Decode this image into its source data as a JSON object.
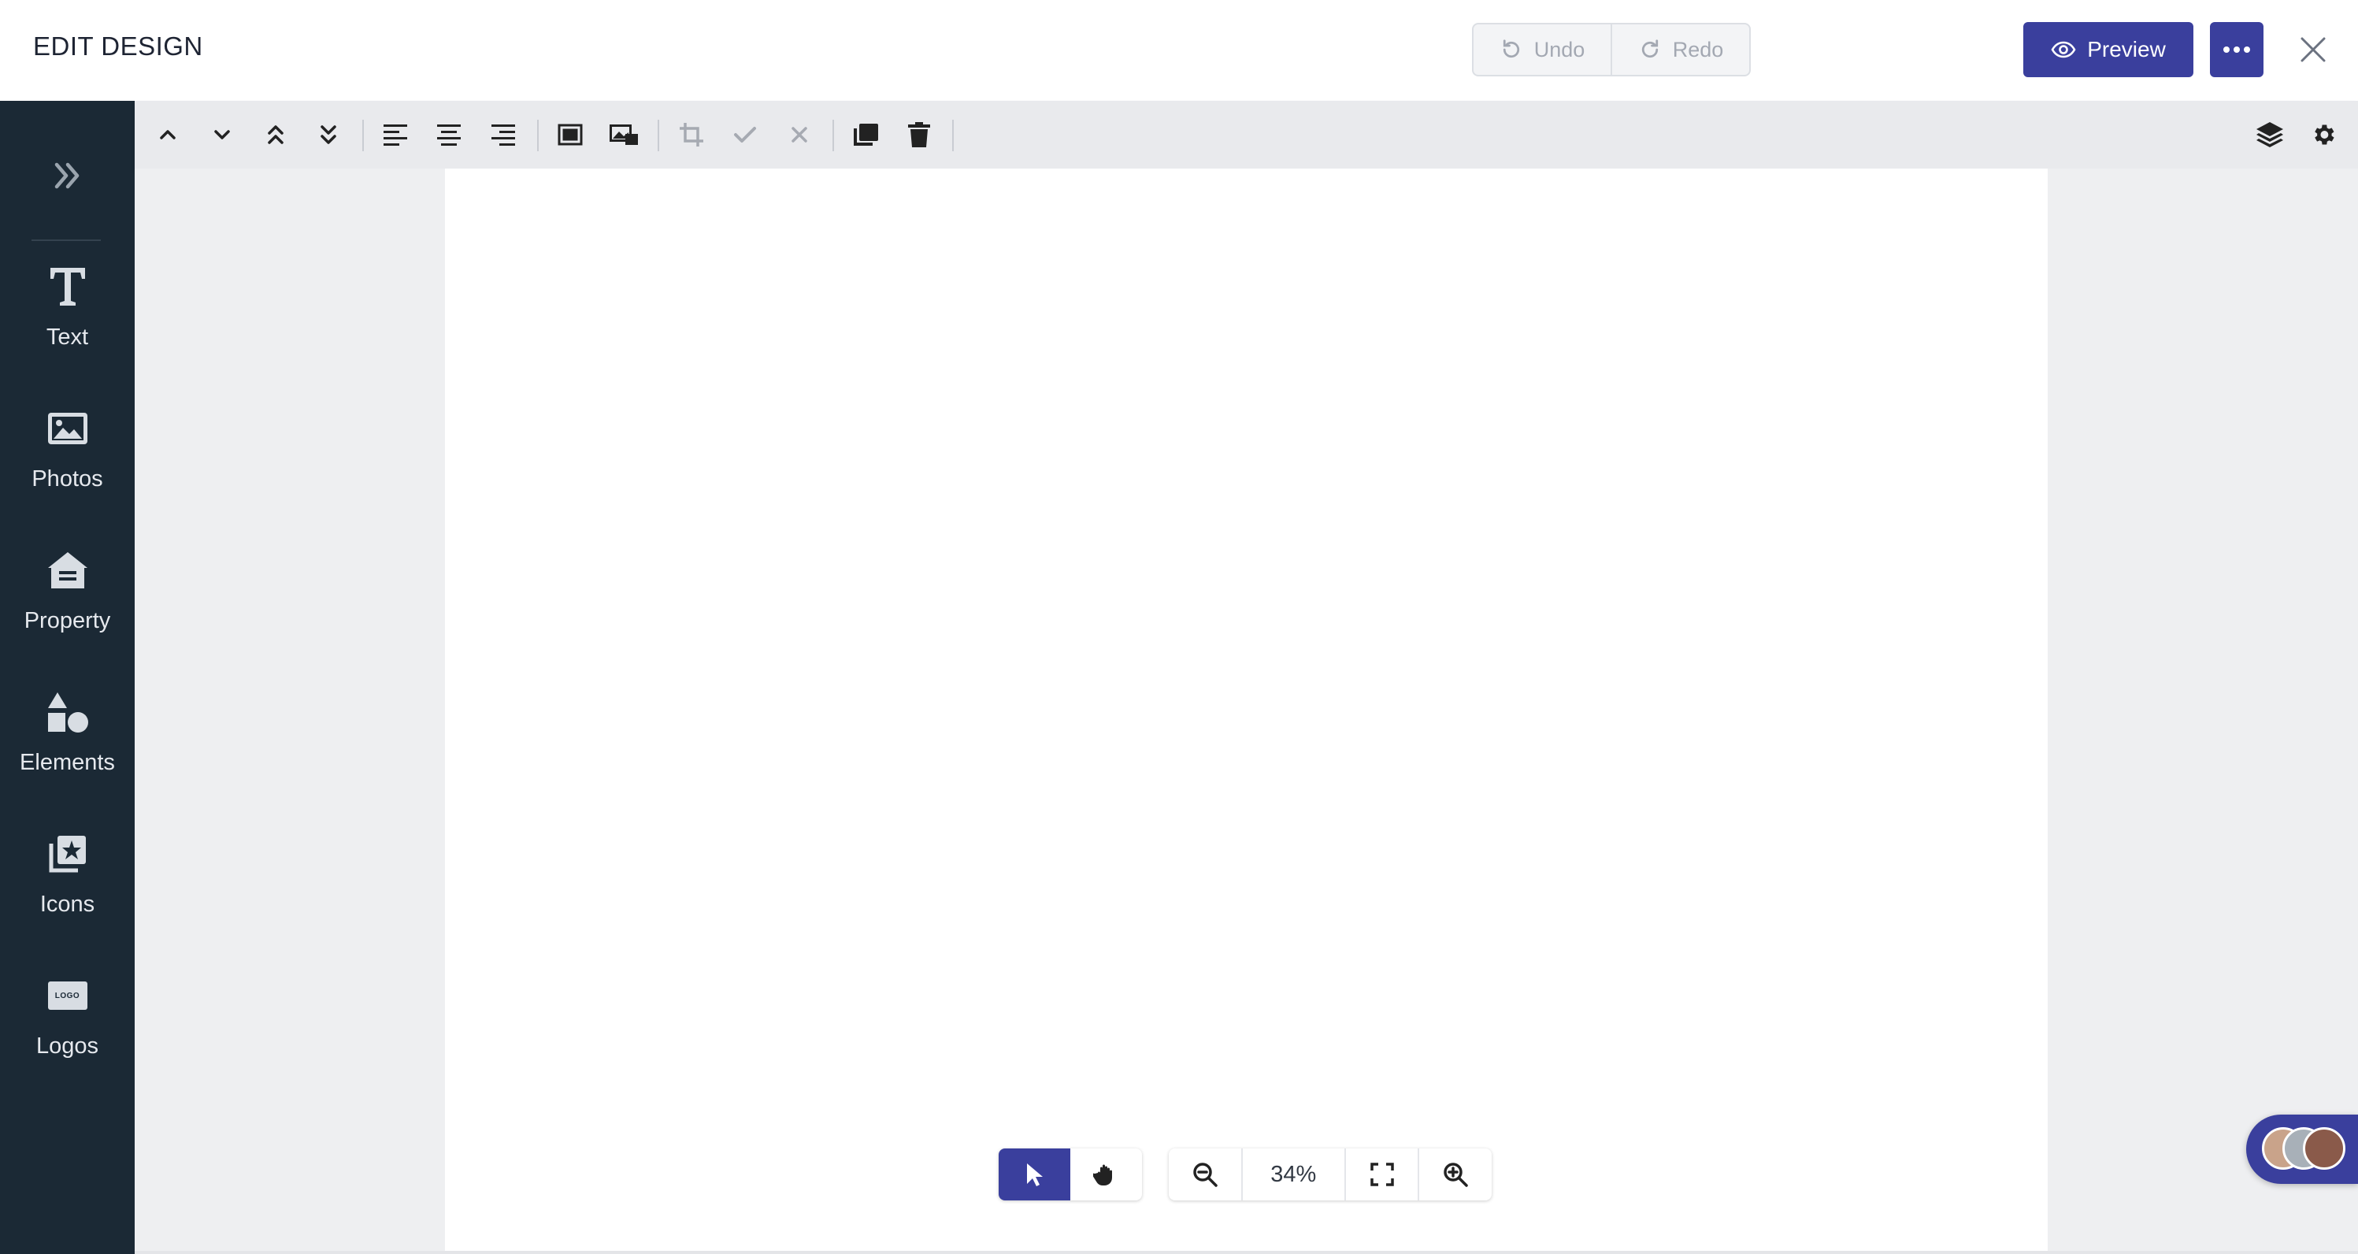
{
  "header": {
    "title": "EDIT DESIGN",
    "undo_label": "Undo",
    "redo_label": "Redo",
    "preview_label": "Preview"
  },
  "sidebar": {
    "items": [
      {
        "label": "Text",
        "icon": "text-icon"
      },
      {
        "label": "Photos",
        "icon": "photo-icon"
      },
      {
        "label": "Property",
        "icon": "house-icon"
      },
      {
        "label": "Elements",
        "icon": "shapes-icon"
      },
      {
        "label": "Icons",
        "icon": "star-collection-icon"
      },
      {
        "label": "Logos",
        "icon": "logo-icon"
      }
    ],
    "logo_badge_text": "LOGO"
  },
  "canvas": {
    "zoom": "34%"
  },
  "colors": {
    "accent": "#3a3f9d",
    "sidebar_bg": "#1b2935",
    "toolbar_bg": "#e9eaed"
  }
}
